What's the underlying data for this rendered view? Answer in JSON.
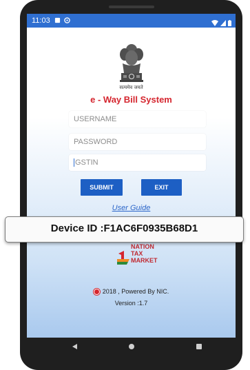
{
  "status_bar": {
    "time": "11:03",
    "icons": [
      "notification-square-icon",
      "clock-circle-icon",
      "wifi-icon",
      "signal-icon",
      "battery-icon"
    ]
  },
  "header": {
    "emblem": "ashoka-emblem-icon",
    "motto": "सत्यमेव जयते",
    "title": "e - Way Bill System"
  },
  "form": {
    "username_placeholder": "USERNAME",
    "password_placeholder": "PASSWORD",
    "gstin_placeholder": "GSTIN"
  },
  "buttons": {
    "submit_label": "SUBMIT",
    "exit_label": "EXIT"
  },
  "links": {
    "user_guide": "User Guide"
  },
  "device_bar": {
    "text": "Device ID :F1AC6F0935B68D1"
  },
  "branding": {
    "lines": [
      "NATION",
      "TAX",
      "MARKET"
    ]
  },
  "footer": {
    "copyright": "2018 , Powered By NIC.",
    "version": "Version :1.7"
  },
  "colors": {
    "primary_blue": "#1d5fc4",
    "status_bar_blue": "#2f6fd1",
    "title_red": "#d5262f",
    "link_blue": "#2c66c9"
  }
}
